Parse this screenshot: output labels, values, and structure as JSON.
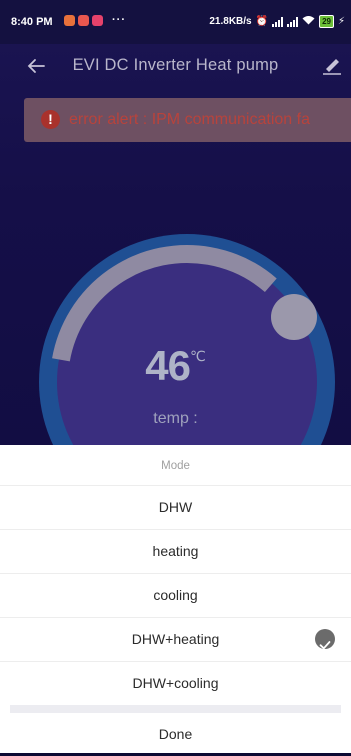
{
  "status_bar": {
    "time": "8:40 PM",
    "more": "···",
    "speed": "21.8KB/s",
    "battery": "29"
  },
  "header": {
    "title": "EVI DC Inverter Heat pump"
  },
  "alert": {
    "text": "error alert : IPM  communication fa"
  },
  "gauge": {
    "value": "46",
    "unit": "℃",
    "temp_label": "temp :",
    "level": 0.25,
    "colors": {
      "track": "#8f8aa2",
      "ring_outer": "#1f4f93",
      "ring_inner": "#3a2e7f",
      "knob": "#9b98ab"
    }
  },
  "mode_sheet": {
    "title": "Mode",
    "options": [
      {
        "label": "DHW",
        "selected": false
      },
      {
        "label": "heating",
        "selected": false
      },
      {
        "label": "cooling",
        "selected": false
      },
      {
        "label": "DHW+heating",
        "selected": true
      },
      {
        "label": "DHW+cooling",
        "selected": false
      }
    ],
    "done_label": "Done",
    "check_color": "#6b6b6b"
  }
}
